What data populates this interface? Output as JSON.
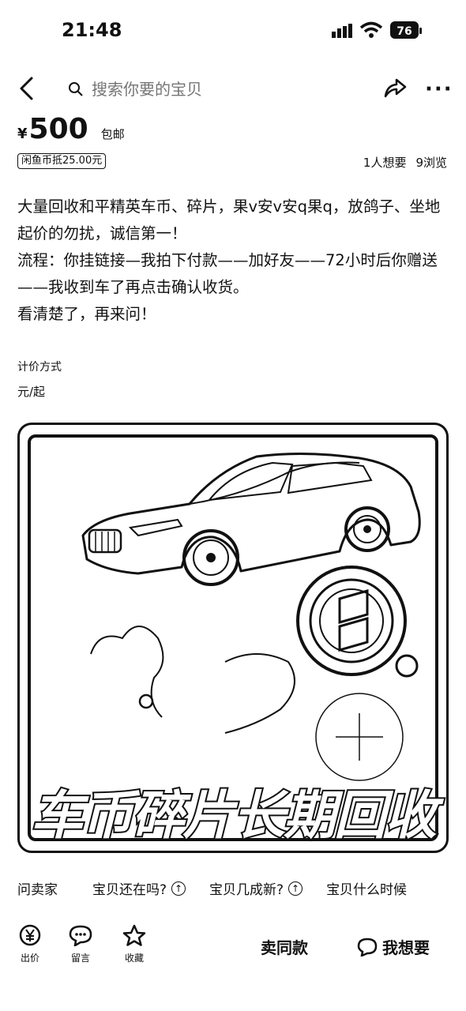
{
  "status_bar": {
    "time": "21:48",
    "battery": "76"
  },
  "nav": {
    "search_placeholder": "搜索你要的宝贝"
  },
  "price": {
    "symbol": "¥",
    "amount": "500",
    "shipping": "包邮",
    "coin_deduct": "闲鱼币抵25.00元"
  },
  "stats": {
    "wants": "1人想要",
    "views": "9浏览"
  },
  "description": [
    "大量回收和平精英车币、碎片，果v安v安q果q，放鸽子、坐地起价的勿扰，诚信第一！",
    "流程：你挂链接—我拍下付款——加好友——72小时后你赠送——我收到车了再点击确认收货。",
    "看清楚了，再来问！"
  ],
  "pricing": {
    "label": "计价方式",
    "value": "元/起"
  },
  "product_image": {
    "banner_text": "车币碎片长期回收"
  },
  "quick_questions": {
    "ask": "问卖家",
    "items": [
      "宝贝还在吗?",
      "宝贝几成新?",
      "宝贝什么时候"
    ]
  },
  "bottom_bar": {
    "bid": "出价",
    "comment": "留言",
    "favorite": "收藏",
    "sell_same": "卖同款",
    "want": "我想要"
  }
}
